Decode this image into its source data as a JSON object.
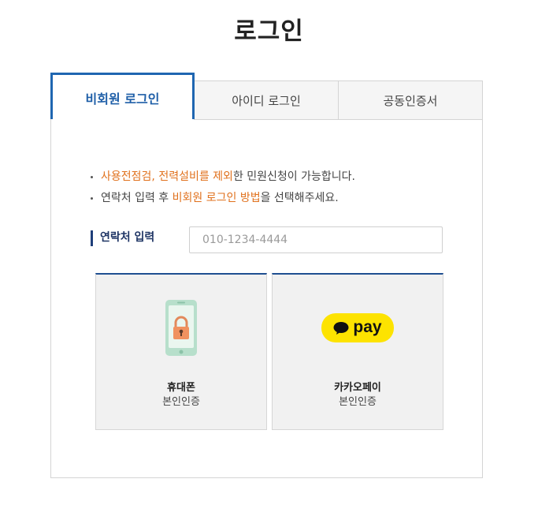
{
  "page": {
    "title": "로그인"
  },
  "tabs": [
    {
      "label": "비회원 로그인",
      "active": true
    },
    {
      "label": "아이디 로그인",
      "active": false
    },
    {
      "label": "공동인증서",
      "active": false
    }
  ],
  "notice": {
    "line1": {
      "highlight_a": "사용전점검",
      "sep": ", ",
      "highlight_b": "전력설비를 제외",
      "rest": "한 민원신청이 가능합니다."
    },
    "line2": {
      "prefix": "연락처 입력 후 ",
      "highlight": "비회원 로그인 방법",
      "rest": "을 선택해주세요."
    }
  },
  "phone": {
    "label": "연락처 입력",
    "placeholder": "010-1234-4444",
    "value": ""
  },
  "methods": [
    {
      "title": "휴대폰",
      "subtitle": "본인인증",
      "icon": "smartphone-lock-icon"
    },
    {
      "title": "카카오페이",
      "subtitle": "본인인증",
      "icon": "kakaopay-logo",
      "logo_text": "pay"
    }
  ],
  "colors": {
    "accent": "#1f66b1",
    "highlight": "#e0711d",
    "kakao_yellow": "#fde300",
    "card_bg": "#f1f1f1"
  }
}
